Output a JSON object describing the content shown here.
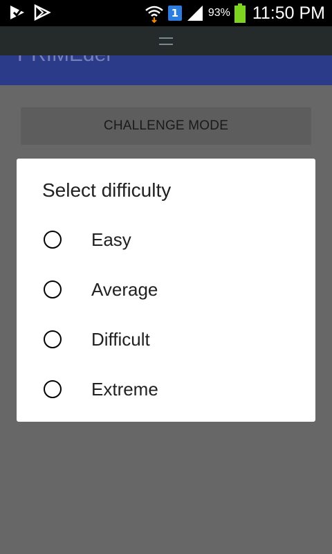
{
  "status_bar": {
    "notification_badge": "1",
    "battery_percent": "93%",
    "time": "11:50 PM",
    "icons": [
      "download-done-icon",
      "play-store-icon",
      "wifi-icon",
      "notification-1-icon",
      "signal-icon",
      "battery-icon"
    ]
  },
  "app": {
    "title": "PRIMEder"
  },
  "main": {
    "challenge_button_label": "CHALLENGE MODE"
  },
  "dialog": {
    "title": "Select difficulty",
    "options": [
      {
        "label": "Easy",
        "selected": false
      },
      {
        "label": "Average",
        "selected": false
      },
      {
        "label": "Difficult",
        "selected": false
      },
      {
        "label": "Extreme",
        "selected": false
      }
    ]
  },
  "colors": {
    "scrim": "#666666",
    "app_bar": "#3F51B5",
    "battery": "#7ed321",
    "dialog_bg": "#ffffff"
  }
}
